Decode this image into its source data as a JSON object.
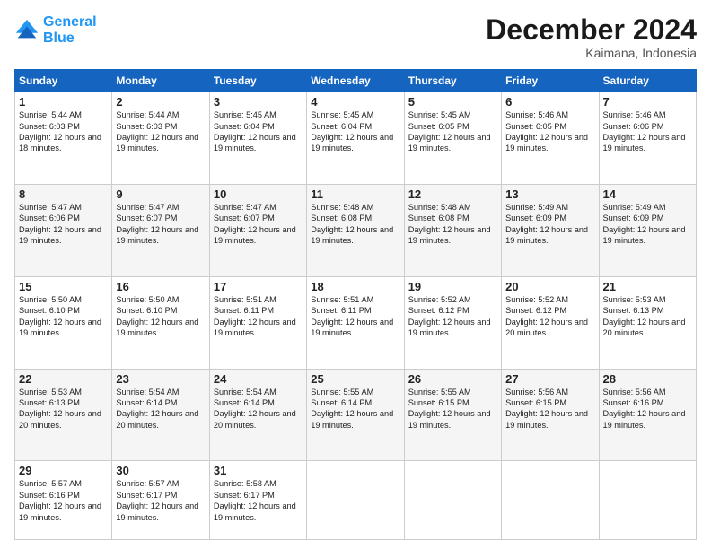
{
  "header": {
    "logo_line1": "General",
    "logo_line2": "Blue",
    "title": "December 2024",
    "location": "Kaimana, Indonesia"
  },
  "calendar": {
    "days_of_week": [
      "Sunday",
      "Monday",
      "Tuesday",
      "Wednesday",
      "Thursday",
      "Friday",
      "Saturday"
    ],
    "weeks": [
      [
        {
          "day": "1",
          "sunrise": "5:44 AM",
          "sunset": "6:03 PM",
          "daylight": "12 hours and 18 minutes."
        },
        {
          "day": "2",
          "sunrise": "5:44 AM",
          "sunset": "6:03 PM",
          "daylight": "12 hours and 19 minutes."
        },
        {
          "day": "3",
          "sunrise": "5:45 AM",
          "sunset": "6:04 PM",
          "daylight": "12 hours and 19 minutes."
        },
        {
          "day": "4",
          "sunrise": "5:45 AM",
          "sunset": "6:04 PM",
          "daylight": "12 hours and 19 minutes."
        },
        {
          "day": "5",
          "sunrise": "5:45 AM",
          "sunset": "6:05 PM",
          "daylight": "12 hours and 19 minutes."
        },
        {
          "day": "6",
          "sunrise": "5:46 AM",
          "sunset": "6:05 PM",
          "daylight": "12 hours and 19 minutes."
        },
        {
          "day": "7",
          "sunrise": "5:46 AM",
          "sunset": "6:06 PM",
          "daylight": "12 hours and 19 minutes."
        }
      ],
      [
        {
          "day": "8",
          "sunrise": "5:47 AM",
          "sunset": "6:06 PM",
          "daylight": "12 hours and 19 minutes."
        },
        {
          "day": "9",
          "sunrise": "5:47 AM",
          "sunset": "6:07 PM",
          "daylight": "12 hours and 19 minutes."
        },
        {
          "day": "10",
          "sunrise": "5:47 AM",
          "sunset": "6:07 PM",
          "daylight": "12 hours and 19 minutes."
        },
        {
          "day": "11",
          "sunrise": "5:48 AM",
          "sunset": "6:08 PM",
          "daylight": "12 hours and 19 minutes."
        },
        {
          "day": "12",
          "sunrise": "5:48 AM",
          "sunset": "6:08 PM",
          "daylight": "12 hours and 19 minutes."
        },
        {
          "day": "13",
          "sunrise": "5:49 AM",
          "sunset": "6:09 PM",
          "daylight": "12 hours and 19 minutes."
        },
        {
          "day": "14",
          "sunrise": "5:49 AM",
          "sunset": "6:09 PM",
          "daylight": "12 hours and 19 minutes."
        }
      ],
      [
        {
          "day": "15",
          "sunrise": "5:50 AM",
          "sunset": "6:10 PM",
          "daylight": "12 hours and 19 minutes."
        },
        {
          "day": "16",
          "sunrise": "5:50 AM",
          "sunset": "6:10 PM",
          "daylight": "12 hours and 19 minutes."
        },
        {
          "day": "17",
          "sunrise": "5:51 AM",
          "sunset": "6:11 PM",
          "daylight": "12 hours and 19 minutes."
        },
        {
          "day": "18",
          "sunrise": "5:51 AM",
          "sunset": "6:11 PM",
          "daylight": "12 hours and 19 minutes."
        },
        {
          "day": "19",
          "sunrise": "5:52 AM",
          "sunset": "6:12 PM",
          "daylight": "12 hours and 19 minutes."
        },
        {
          "day": "20",
          "sunrise": "5:52 AM",
          "sunset": "6:12 PM",
          "daylight": "12 hours and 20 minutes."
        },
        {
          "day": "21",
          "sunrise": "5:53 AM",
          "sunset": "6:13 PM",
          "daylight": "12 hours and 20 minutes."
        }
      ],
      [
        {
          "day": "22",
          "sunrise": "5:53 AM",
          "sunset": "6:13 PM",
          "daylight": "12 hours and 20 minutes."
        },
        {
          "day": "23",
          "sunrise": "5:54 AM",
          "sunset": "6:14 PM",
          "daylight": "12 hours and 20 minutes."
        },
        {
          "day": "24",
          "sunrise": "5:54 AM",
          "sunset": "6:14 PM",
          "daylight": "12 hours and 20 minutes."
        },
        {
          "day": "25",
          "sunrise": "5:55 AM",
          "sunset": "6:14 PM",
          "daylight": "12 hours and 19 minutes."
        },
        {
          "day": "26",
          "sunrise": "5:55 AM",
          "sunset": "6:15 PM",
          "daylight": "12 hours and 19 minutes."
        },
        {
          "day": "27",
          "sunrise": "5:56 AM",
          "sunset": "6:15 PM",
          "daylight": "12 hours and 19 minutes."
        },
        {
          "day": "28",
          "sunrise": "5:56 AM",
          "sunset": "6:16 PM",
          "daylight": "12 hours and 19 minutes."
        }
      ],
      [
        {
          "day": "29",
          "sunrise": "5:57 AM",
          "sunset": "6:16 PM",
          "daylight": "12 hours and 19 minutes."
        },
        {
          "day": "30",
          "sunrise": "5:57 AM",
          "sunset": "6:17 PM",
          "daylight": "12 hours and 19 minutes."
        },
        {
          "day": "31",
          "sunrise": "5:58 AM",
          "sunset": "6:17 PM",
          "daylight": "12 hours and 19 minutes."
        },
        null,
        null,
        null,
        null
      ]
    ]
  }
}
